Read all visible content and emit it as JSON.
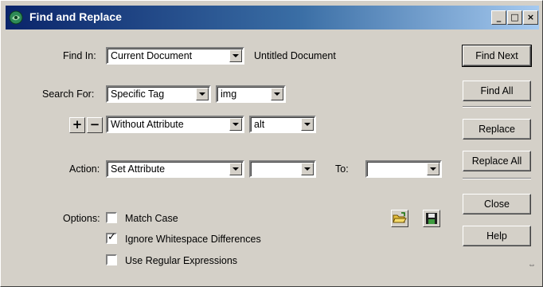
{
  "window": {
    "title": "Find and Replace",
    "minimize_glyph": "_",
    "maximize_glyph": "□",
    "close_glyph": "×"
  },
  "find_in": {
    "label": "Find In:",
    "value": "Current Document",
    "document_name": "Untitled Document"
  },
  "search_for": {
    "label": "Search For:",
    "type_value": "Specific Tag",
    "tag_value": "img"
  },
  "condition": {
    "add_glyph": "+",
    "remove_glyph": "−",
    "modifier_value": "Without Attribute",
    "attribute_value": "alt"
  },
  "action": {
    "label": "Action:",
    "value": "Set Attribute",
    "attribute_value": "",
    "to_label": "To:",
    "to_value": ""
  },
  "options": {
    "label": "Options:",
    "match_case": {
      "label": "Match Case",
      "checked": false
    },
    "ignore_whitespace": {
      "label": "Ignore Whitespace Differences",
      "checked": true
    },
    "use_regex": {
      "label": "Use Regular Expressions",
      "checked": false
    }
  },
  "buttons": {
    "find_next": "Find Next",
    "find_all": "Find All",
    "replace": "Replace",
    "replace_all": "Replace All",
    "close": "Close",
    "help": "Help"
  },
  "colors": {
    "titlebar_start": "#0a246a",
    "titlebar_end": "#a6caf0",
    "face": "#d4d0c8"
  }
}
